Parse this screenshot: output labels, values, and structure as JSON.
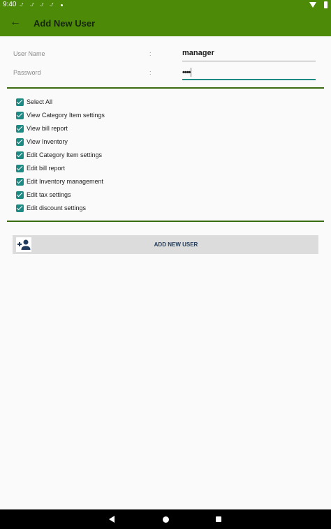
{
  "status_bar": {
    "time": "9:40",
    "notification_icons": [
      "download-done-icon",
      "download-done-icon",
      "download-done-icon",
      "download-done-icon"
    ],
    "notification_glyph": "⍻",
    "right_icons": [
      "wifi-icon",
      "battery-icon"
    ]
  },
  "app_bar": {
    "back_icon": "arrow-back-icon",
    "back_glyph": "←",
    "title": "Add New User",
    "color": "#4c8a08"
  },
  "form": {
    "username": {
      "label": "User Name",
      "colon": ":",
      "value": "manager"
    },
    "password": {
      "label": "Password",
      "colon": ":",
      "value": "••••"
    }
  },
  "permissions": [
    {
      "label": "Select All",
      "checked": true
    },
    {
      "label": "View Category Item settings",
      "checked": true
    },
    {
      "label": "View bill report",
      "checked": true
    },
    {
      "label": "View Inventory",
      "checked": true
    },
    {
      "label": "Edit Category Item settings",
      "checked": true
    },
    {
      "label": "Edit bill report",
      "checked": true
    },
    {
      "label": "Edit Inventory management",
      "checked": true
    },
    {
      "label": "Edit tax settings",
      "checked": true
    },
    {
      "label": "Edit discount settings",
      "checked": true
    }
  ],
  "add_button": {
    "icon": "add-user-icon",
    "label": "ADD NEW USER"
  },
  "colors": {
    "accent": "#1e8a84",
    "header": "#4c8a08",
    "divider": "#3a6b12"
  }
}
